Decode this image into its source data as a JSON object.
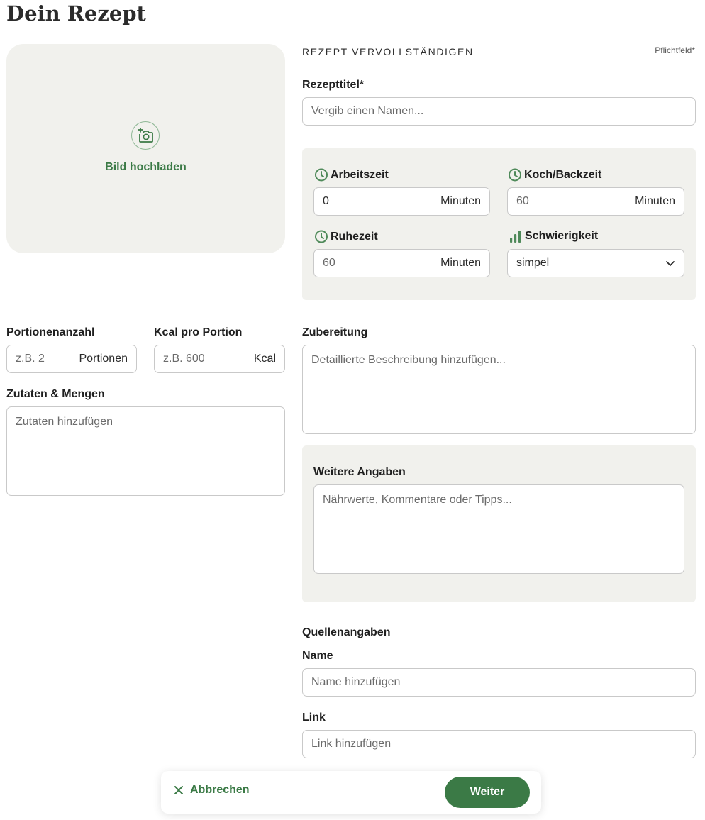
{
  "page": {
    "title": "Dein Rezept"
  },
  "upload": {
    "label": "Bild hochladen",
    "icon": "camera-add-icon"
  },
  "form": {
    "section_heading": "REZEPT VERVOLLSTÄNDIGEN",
    "required_note": "Pflichtfeld*",
    "title_label": "Rezepttitel*",
    "title_placeholder": "Vergib einen Namen...",
    "times": {
      "work": {
        "label": "Arbeitszeit",
        "value": "0",
        "unit": "Minuten",
        "icon": "clock-icon"
      },
      "cook": {
        "label": "Koch/Backzeit",
        "value": "60",
        "unit": "Minuten",
        "icon": "clock-icon"
      },
      "rest": {
        "label": "Ruhezeit",
        "value": "60",
        "unit": "Minuten",
        "icon": "clock-icon"
      },
      "difficulty": {
        "label": "Schwierigkeit",
        "value": "simpel",
        "icon": "difficulty-bars-icon"
      }
    },
    "portions": {
      "label": "Portionenanzahl",
      "placeholder": "z.B. 2",
      "unit": "Portionen"
    },
    "kcal": {
      "label": "Kcal pro Portion",
      "placeholder": "z.B. 600",
      "unit": "Kcal"
    },
    "ingredients": {
      "label": "Zutaten & Mengen",
      "placeholder": "Zutaten hinzufügen"
    },
    "preparation": {
      "label": "Zubereitung",
      "placeholder": "Detaillierte Beschreibung hinzufügen..."
    },
    "extra": {
      "label": "Weitere Angaben",
      "placeholder": "Nährwerte, Kommentare oder Tipps..."
    },
    "sources": {
      "heading": "Quellenangaben",
      "name_label": "Name",
      "name_placeholder": "Name hinzufügen",
      "link_label": "Link",
      "link_placeholder": "Link hinzufügen"
    }
  },
  "footer": {
    "cancel_label": "Abbrechen",
    "next_label": "Weiter"
  },
  "colors": {
    "accent": "#3b7a46",
    "panel": "#f1f1ed",
    "border": "#c9c9c9"
  }
}
